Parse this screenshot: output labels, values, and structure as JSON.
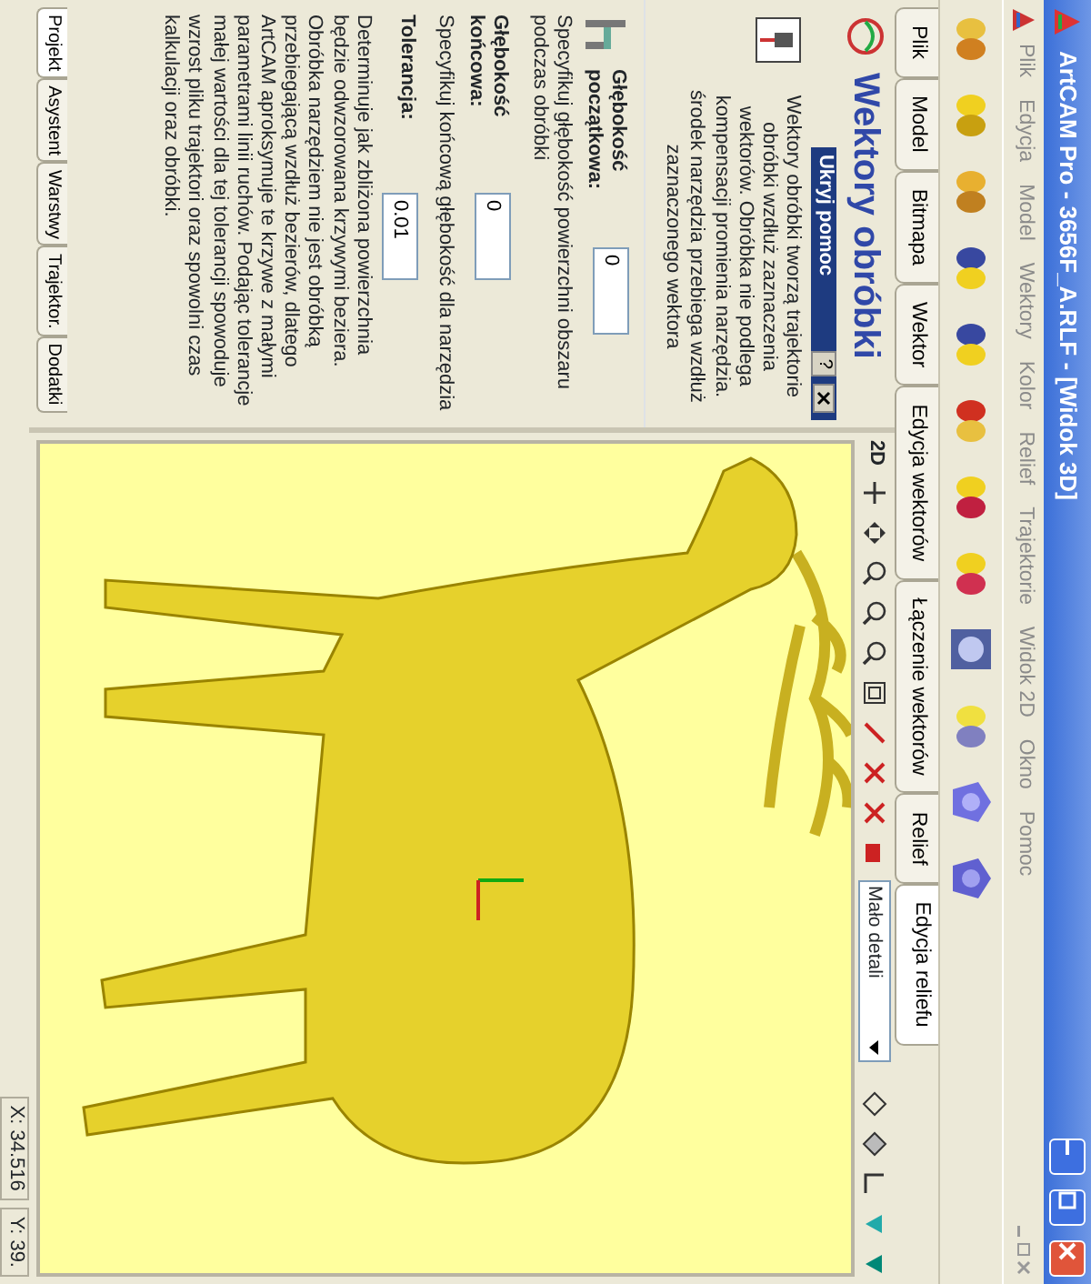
{
  "window": {
    "title": "ArtCAM Pro - 3656F_A.RLF - [Widok 3D]"
  },
  "menu": [
    "Plik",
    "Edycja",
    "Model",
    "Wektory",
    "Kolor",
    "Relief",
    "Trajektorie",
    "Widok 2D",
    "Okno",
    "Pomoc"
  ],
  "tabs": [
    {
      "label": "Plik",
      "selected": false
    },
    {
      "label": "Model",
      "selected": false
    },
    {
      "label": "Bitmapa",
      "selected": false
    },
    {
      "label": "Wektor",
      "selected": false
    },
    {
      "label": "Edycja wektorów",
      "selected": false
    },
    {
      "label": "Łączenie wektorów",
      "selected": false
    },
    {
      "label": "Relief",
      "selected": false
    },
    {
      "label": "Edycja reliefu",
      "selected": true
    }
  ],
  "panel": {
    "title": "Wektory obróbki",
    "help_header": "Ukryj pomoc",
    "help_button": "?",
    "help_text": "Wektory obróbki tworzą trajektorie obróbki wzdłuż zaznaczenia wektorów. Obróbka nie podlega kompensacji promienia narzędzia. środek narzędzia przebiega wzdłuż zaznaczonego wektora",
    "fields": [
      {
        "label": "Głębokość początkowa:",
        "value": "0",
        "description": "Specyfikuj głębokość powierzchni obszaru podczas obróbki"
      },
      {
        "label": "Głębokość końcowa:",
        "value": "0",
        "description": "Specyfikuj końcową głębokość dla narzędzia"
      },
      {
        "label": "Tolerancja:",
        "value": "0.01",
        "description": "Determinuje jak zbliżona powierzchnia będzie odwzorowana krzywymi beziera. Obróbka narzędziem nie jest obróbką przebiegającą wzdłuż bezierów, dlatego ArtCAM aproksymuje te krzywe z małymi parametrami linii ruchów. Podając tolerancje małej wartości dla tej tolerancji spowoduje wzrost pliku trajektori oraz spowolni czas kalkulacji oraz obróbki."
      }
    ]
  },
  "bottom_tabs": [
    {
      "label": "Projekt",
      "selected": true
    },
    {
      "label": "Asystent",
      "selected": false
    },
    {
      "label": "Warstwy",
      "selected": false
    },
    {
      "label": "Trajektor.",
      "selected": false
    },
    {
      "label": "Dodatki",
      "selected": false
    }
  ],
  "view": {
    "mode": "2D",
    "detail": "Mało detali"
  },
  "status_bar": [
    "X: 34.516",
    "Y: 39."
  ]
}
